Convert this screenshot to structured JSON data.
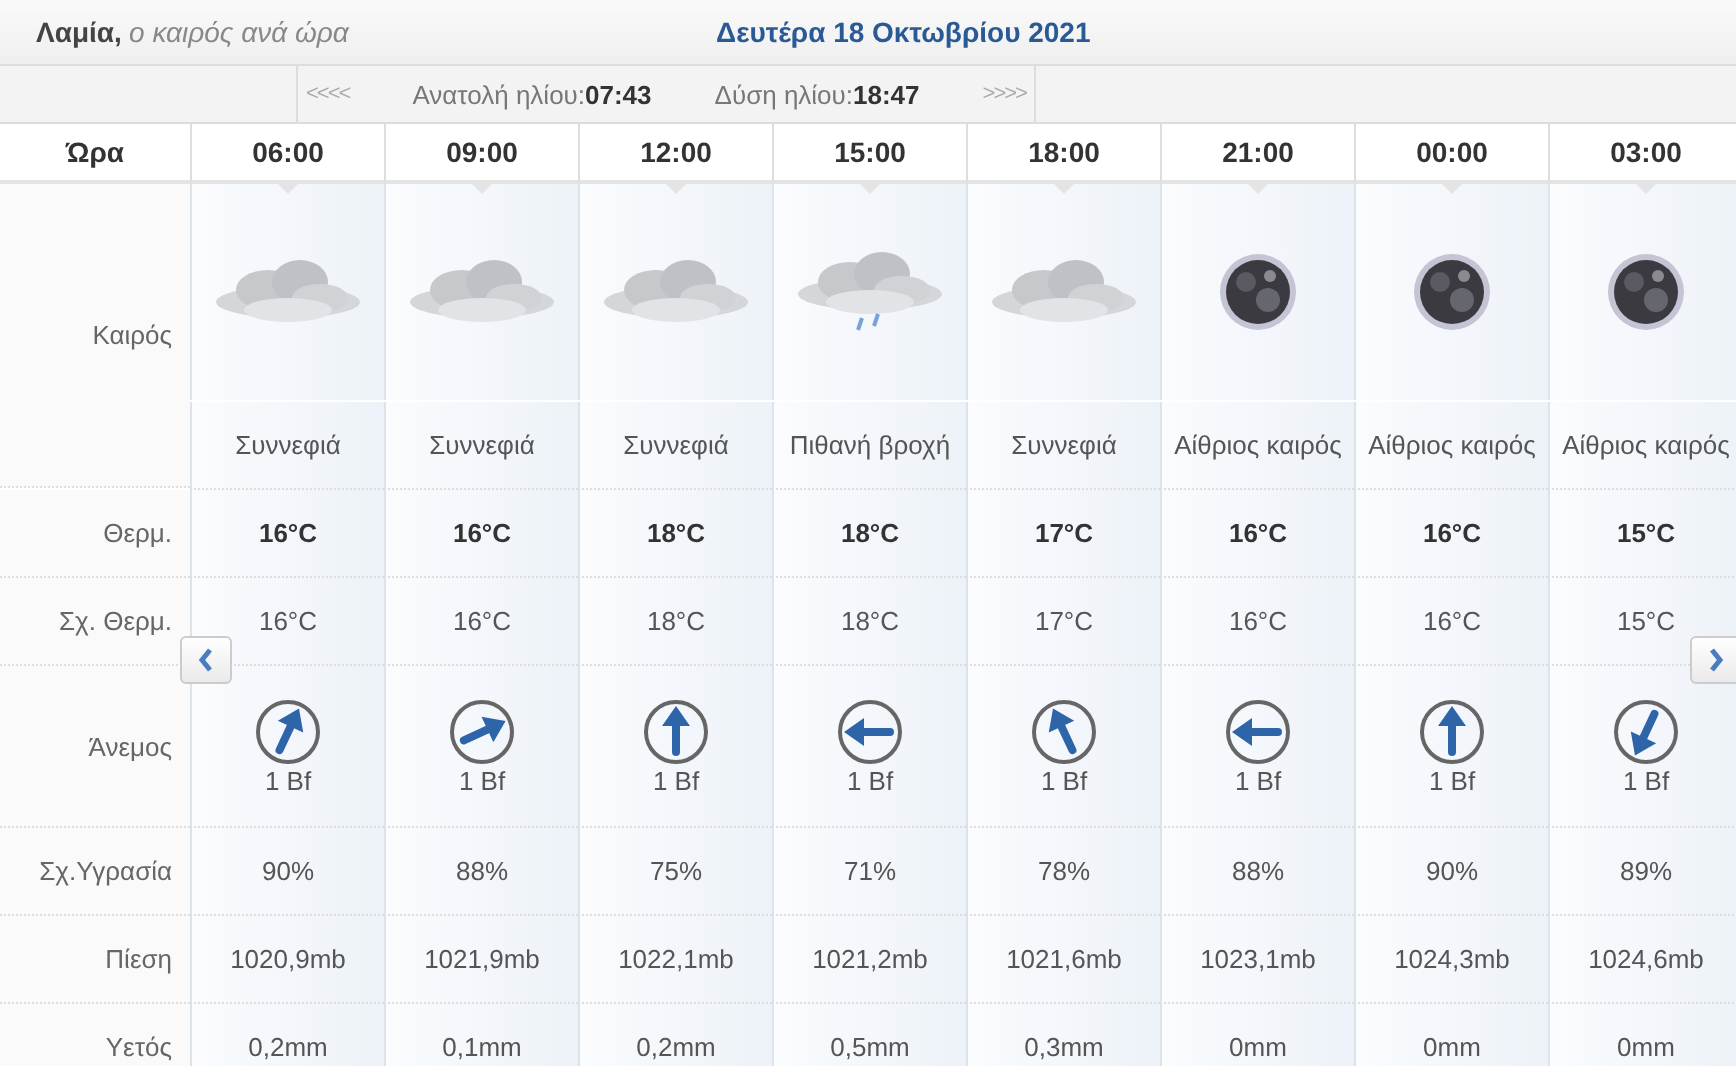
{
  "header": {
    "city": "Λαμία,",
    "subtitle": "ο καιρός ανά ώρα",
    "date": "Δευτέρα 18 Οκτωβρίου 2021"
  },
  "sun": {
    "prev": "<<<<",
    "sunrise_label": "Ανατολή ηλίου:",
    "sunrise": "07:43",
    "sunset_label": "Δύση ηλίου:",
    "sunset": "18:47",
    "next": ">>>>"
  },
  "row_labels": {
    "time": "Ώρα",
    "weather": "Καιρός",
    "temp": "Θερμ.",
    "feels": "Σχ. Θερμ.",
    "wind": "Άνεμος",
    "humidity": "Σχ.Υγρασία",
    "pressure": "Πίεση",
    "rain": "Υετός"
  },
  "hours": [
    {
      "time": "06:00",
      "kind": "cloudy",
      "desc": "Συννεφιά",
      "temp": "16°C",
      "feels": "16°C",
      "wind": {
        "kind": "nne",
        "speed": "1 Bf"
      },
      "humidity": "90%",
      "pressure": "1020,9mb",
      "rain": "0,2mm"
    },
    {
      "time": "09:00",
      "kind": "cloudy",
      "desc": "Συννεφιά",
      "temp": "16°C",
      "feels": "16°C",
      "wind": {
        "kind": "ene",
        "speed": "1 Bf"
      },
      "humidity": "88%",
      "pressure": "1021,9mb",
      "rain": "0,1mm"
    },
    {
      "time": "12:00",
      "kind": "cloudy",
      "desc": "Συννεφιά",
      "temp": "18°C",
      "feels": "18°C",
      "wind": {
        "kind": "n",
        "speed": "1 Bf"
      },
      "humidity": "75%",
      "pressure": "1022,1mb",
      "rain": "0,2mm"
    },
    {
      "time": "15:00",
      "kind": "rain",
      "desc": "Πιθανή βροχή",
      "temp": "18°C",
      "feels": "18°C",
      "wind": {
        "kind": "w",
        "speed": "1 Bf"
      },
      "humidity": "71%",
      "pressure": "1021,2mb",
      "rain": "0,5mm"
    },
    {
      "time": "18:00",
      "kind": "cloudy",
      "desc": "Συννεφιά",
      "temp": "17°C",
      "feels": "17°C",
      "wind": {
        "kind": "nnw",
        "speed": "1 Bf"
      },
      "humidity": "78%",
      "pressure": "1021,6mb",
      "rain": "0,3mm"
    },
    {
      "time": "21:00",
      "kind": "moon",
      "desc": "Αίθριος καιρός",
      "temp": "16°C",
      "feels": "16°C",
      "wind": {
        "kind": "w",
        "speed": "1 Bf"
      },
      "humidity": "88%",
      "pressure": "1023,1mb",
      "rain": "0mm"
    },
    {
      "time": "00:00",
      "kind": "moon",
      "desc": "Αίθριος καιρός",
      "temp": "16°C",
      "feels": "16°C",
      "wind": {
        "kind": "n",
        "speed": "1 Bf"
      },
      "humidity": "90%",
      "pressure": "1024,3mb",
      "rain": "0mm"
    },
    {
      "time": "03:00",
      "kind": "moon",
      "desc": "Αίθριος καιρός",
      "temp": "15°C",
      "feels": "15°C",
      "wind": {
        "kind": "ssw",
        "speed": "1 Bf"
      },
      "humidity": "89%",
      "pressure": "1024,6mb",
      "rain": "0mm"
    }
  ]
}
